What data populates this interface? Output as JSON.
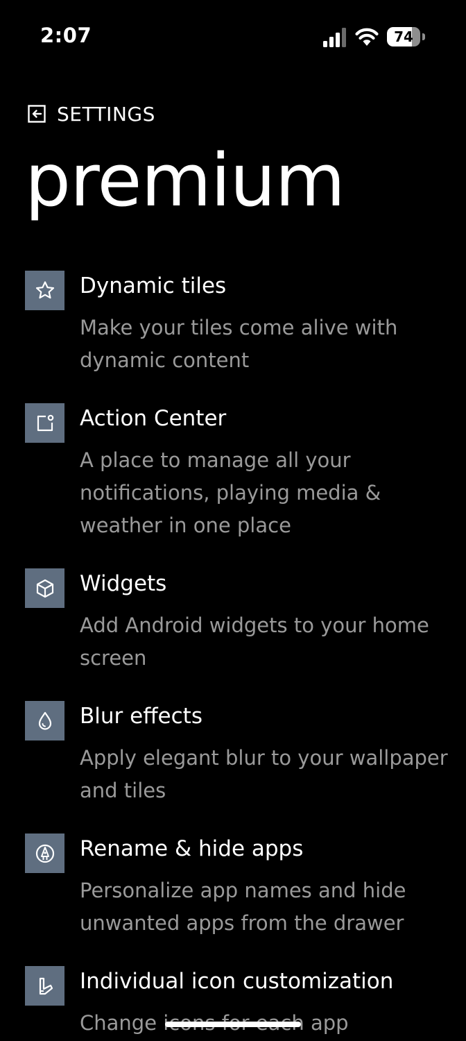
{
  "status_bar": {
    "time": "2:07",
    "battery_level": "74",
    "battery_fraction": 0.74
  },
  "header": {
    "back_label": "SETTINGS",
    "title": "premium"
  },
  "theme": {
    "tile_color": "#5f6e80",
    "description_color": "#9a9a9a",
    "background": "#000000"
  },
  "features": [
    {
      "icon": "star-icon",
      "title": "Dynamic tiles",
      "description": "Make your tiles come alive with dynamic content"
    },
    {
      "icon": "notification-icon",
      "title": "Action Center",
      "description": "A place to manage all your notifications, playing media & weather in one place"
    },
    {
      "icon": "cube-icon",
      "title": "Widgets",
      "description": "Add Android widgets to your home screen"
    },
    {
      "icon": "drop-icon",
      "title": "Blur effects",
      "description": "Apply elegant blur to your wallpaper and tiles"
    },
    {
      "icon": "pen-icon",
      "title": "Rename & hide apps",
      "description": "Personalize app names and hide unwanted apps from the drawer"
    },
    {
      "icon": "brush-icon",
      "title": "Individual icon customization",
      "description": "Change icons for each app"
    }
  ]
}
